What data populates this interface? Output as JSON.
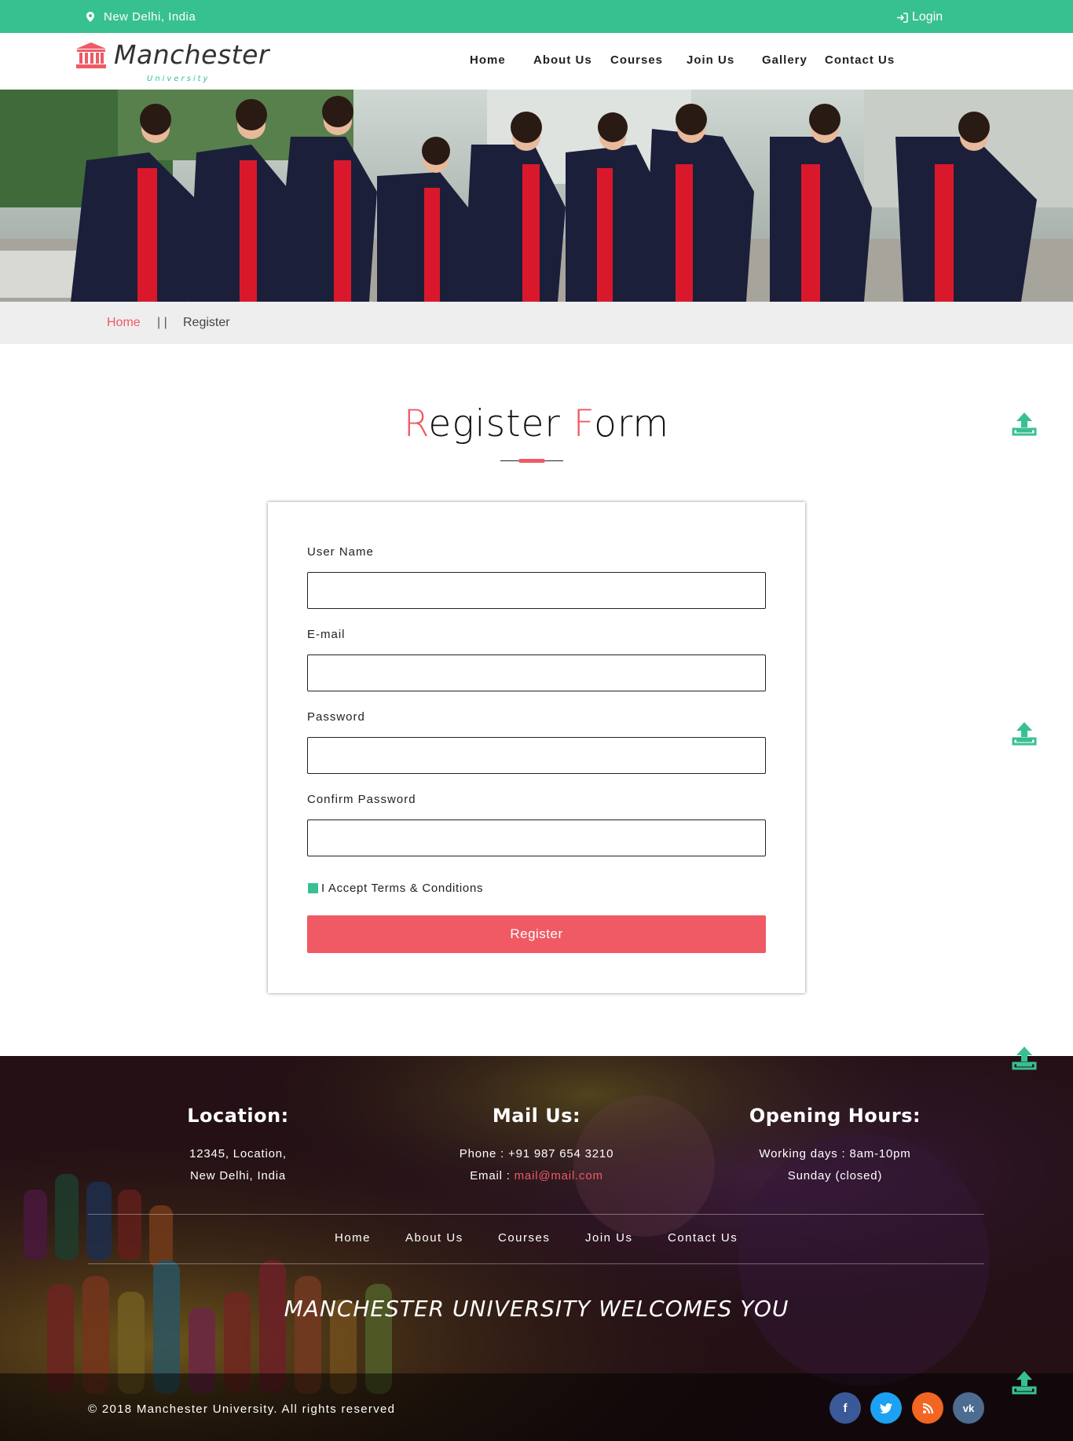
{
  "topbar": {
    "location": "New Delhi, India",
    "login": "Login"
  },
  "brand": {
    "name": "Manchester",
    "tagline": "University"
  },
  "nav": [
    "Home",
    "About Us",
    "Courses",
    "Join Us",
    "Gallery",
    "Contact Us"
  ],
  "breadcrumb": {
    "home": "Home",
    "separator": "| |",
    "current": "Register"
  },
  "heading": {
    "first_initial": "R",
    "first_rest": "egister ",
    "second_initial": "F",
    "second_rest": "orm"
  },
  "form": {
    "username_label": "User Name",
    "email_label": "E-mail",
    "password_label": "Password",
    "confirm_label": "Confirm Password",
    "username_value": "",
    "email_value": "",
    "password_value": "",
    "confirm_value": "",
    "terms_label": "I Accept Terms & Conditions",
    "terms_checked": true,
    "submit_label": "Register"
  },
  "footer": {
    "location": {
      "title": "Location:",
      "line1": "12345, Location,",
      "line2": "New Delhi, India"
    },
    "mail": {
      "title": "Mail Us:",
      "phone": "Phone : +91 987 654 3210",
      "email_prefix": "Email : ",
      "email": "mail@mail.com"
    },
    "hours": {
      "title": "Opening Hours:",
      "line1": "Working days : 8am-10pm",
      "line2": "Sunday (closed)"
    },
    "nav": [
      "Home",
      "About Us",
      "Courses",
      "Join Us",
      "Contact Us"
    ],
    "welcome": "MANCHESTER UNIVERSITY WELCOMES YOU",
    "copyright": "© 2018 Manchester University. All rights reserved"
  },
  "social": [
    {
      "icon": "facebook-icon",
      "glyph": "f",
      "color": "#3b5998"
    },
    {
      "icon": "twitter-icon",
      "glyph": "t",
      "color": "#1da1f2"
    },
    {
      "icon": "rss-icon",
      "glyph": "",
      "color": "#f26522"
    },
    {
      "icon": "vk-icon",
      "glyph": "vk",
      "color": "#4c6c91"
    }
  ],
  "colors": {
    "accent_green": "#38c190",
    "accent_red": "#ef5a64",
    "breadcrumb_bg": "#eeeeee"
  }
}
